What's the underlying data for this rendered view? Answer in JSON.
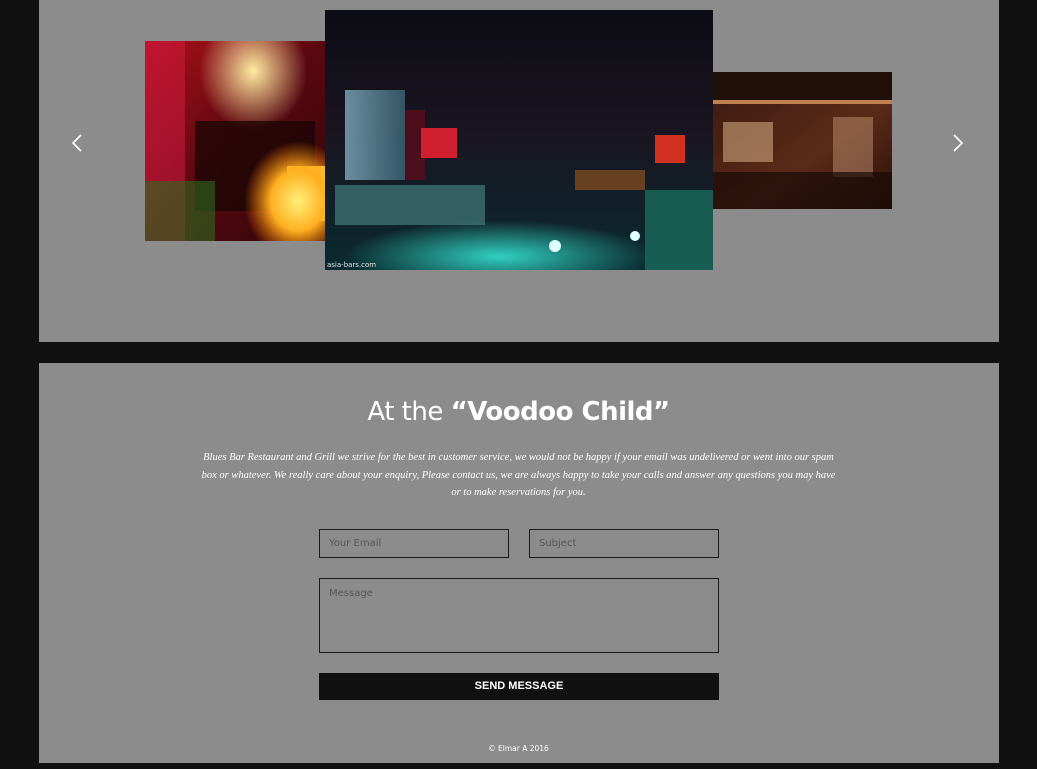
{
  "carousel": {
    "prev_icon": "chevron-left-icon",
    "next_icon": "chevron-right-icon",
    "center_watermark": "asia-bars.com"
  },
  "contact": {
    "title_prefix": "At the ",
    "title_highlight": "“Voodoo Child”",
    "description": "Blues Bar Restaurant and Grill we strive for the best in customer service, we would not be happy if your email was undelivered or went into our spam box or whatever. We really care about your enquiry, Please contact us, we are always happy to take your calls and answer any questions you may have or to make reservations for you.",
    "email_placeholder": "Your Email",
    "subject_placeholder": "Subject",
    "message_placeholder": "Message",
    "send_label": "SEND MESSAGE"
  },
  "footer": {
    "copyright": "© Elmar A 2016"
  },
  "colors": {
    "page_background": "#111111",
    "panel_background": "#8c8c8c",
    "button_background": "#111111",
    "text": "#ffffff"
  }
}
